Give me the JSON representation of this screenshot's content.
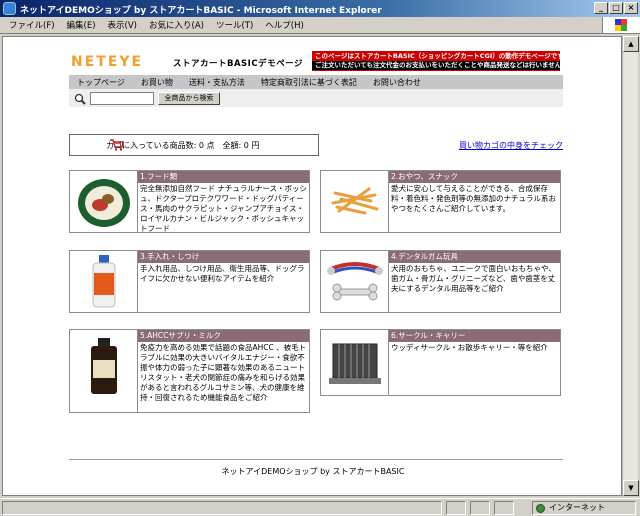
{
  "window": {
    "title": "ネットアイDEMOショップ by ストアカートBASIC - Microsoft Internet Explorer",
    "minimize": "_",
    "maximize": "□",
    "close": "×"
  },
  "menu": [
    "ファイル(F)",
    "編集(E)",
    "表示(V)",
    "お気に入り(A)",
    "ツール(T)",
    "ヘルプ(H)"
  ],
  "page": {
    "logo_neteye": "NETEYE",
    "logo_sub": "ストアカートBASICデモページ",
    "notice_line1": "このページはストアカートBASIC（ショッピングカートCGI）の動作デモページです",
    "notice_line2": "ご注文いただいても注文代金のお支払いをいただくことや商品発送などは行いません",
    "nav": [
      "トップページ",
      "お買い物",
      "送料・支払方法",
      "特定商取引法に基づく表記",
      "お問い合わせ"
    ],
    "search_button": "全商品から検索",
    "search_value": "",
    "cart_summary": "カゴに入っている商品数: 0 点　全額: 0 円",
    "cart_link": "買い物カゴの中身をチェック",
    "categories": [
      {
        "title": "1.フード類",
        "desc": "完全無添加自然フード ナチュラルナース・ボッシュ、ドクタープロテクワワード・ドッグパティース・馬肉のサクラピット・ジャンプアチョイス・ロイヤルカナン・ビルジャック・ボッシュキャットフード"
      },
      {
        "title": "2.おやつ、スナック",
        "desc": "愛犬に安心して与えることができる、合成保存料・着色料・発色剤等の無添加のナチュラル系おやつをたくさんご紹介しています。"
      },
      {
        "title": "3.手入れ・しつけ",
        "desc": "手入れ用品、しつけ用品、衛生用品等、ドッグライフに欠かせない便利なアイテムを紹介"
      },
      {
        "title": "4.デンタルガム玩具",
        "desc": "犬用のおもちゃ、ユニークで面白いおもちゃや、歯ガム・骨ガム・グリニーズなど、歯や歯茎を丈夫にするデンタル用品等をご紹介"
      },
      {
        "title": "5.AHCCサプリ・ミルク",
        "desc": "免疫力を高める効果で話題の食品AHCC 、被毛トラブルに効果の大きいバイタルエナジー・食欲不振や体力の弱った子に顕著な効果のあるニュートリスタット・老犬の関節症の痛みを和らげる効果があると言われるグルコサミン等、犬の健康を維持・回復されるため機能食品をご紹介"
      },
      {
        "title": "6.サークル・キャリー",
        "desc": "ウッディサークル・お散歩キャリー・等を紹介"
      }
    ],
    "footer": "ネットアイDEMOショップ by ストアカートBASIC"
  },
  "status": {
    "zone": "インターネット"
  },
  "colors": {
    "category_header": "#8a6d73",
    "notice_bg": "#cc0000",
    "link": "#0000cc"
  }
}
